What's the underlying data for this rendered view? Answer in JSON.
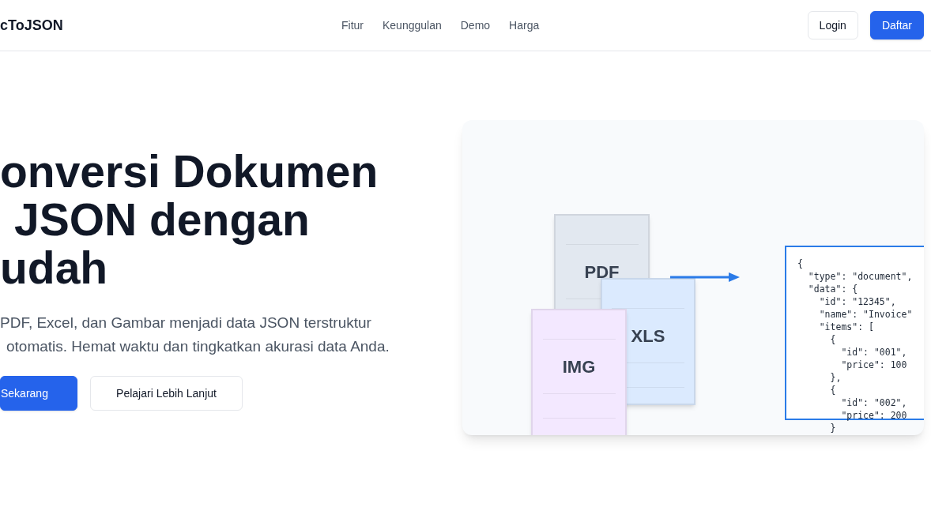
{
  "header": {
    "logo": "cToJSON",
    "nav": [
      "Fitur",
      "Keunggulan",
      "Demo",
      "Harga"
    ],
    "buttons": [
      {
        "label": "Login",
        "kind": "outline"
      },
      {
        "label": "Daftar",
        "kind": "primary"
      }
    ]
  },
  "hero": {
    "title_lines": [
      "onversi Dokumen",
      "JSON dengan",
      "udah"
    ],
    "description_lines": [
      "PDF, Excel, dan Gambar menjadi data JSON terstruktur",
      "otomatis. Hemat waktu dan tingkatkan akurasi data Anda."
    ],
    "buttons": [
      {
        "label": "Sekarang",
        "kind": "primary"
      },
      {
        "label": "Pelajari Lebih Lanjut",
        "kind": "outline"
      }
    ]
  },
  "illustration": {
    "documents": [
      {
        "label": "PDF",
        "color": "#e2e8f0"
      },
      {
        "label": "XLS",
        "color": "#dbeafe"
      },
      {
        "label": "IMG",
        "color": "#f3e8ff"
      }
    ],
    "code_lines": [
      "{",
      "  \"type\": \"document\",",
      "  \"data\": {",
      "    \"id\": \"12345\",",
      "    \"name\": \"Invoice\"",
      "    \"items\": [",
      "      {",
      "        \"id\": \"001\",",
      "        \"price\": 100",
      "      },",
      "      {",
      "        \"id\": \"002\",",
      "        \"price\": 200",
      "      }"
    ]
  }
}
